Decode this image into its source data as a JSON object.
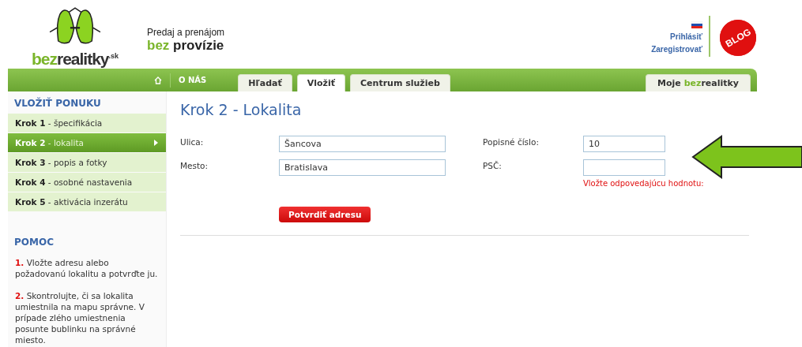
{
  "logo": {
    "brand_a": "bez",
    "brand_b": "realitky",
    "suffix": ".sk"
  },
  "tagline": {
    "line_1": "Predaj a prenájom",
    "accent": "bez",
    "rest": "provízie"
  },
  "account_links": [
    "Prihlásiť",
    "Zaregistrovať"
  ],
  "blog_badge": "BLOG",
  "nav": {
    "about": "O NÁS",
    "tabs": [
      {
        "label": "Hľadať",
        "selected": false
      },
      {
        "label": "Vložiť",
        "selected": true
      },
      {
        "label": "Centrum služieb",
        "selected": false
      }
    ],
    "my_account": {
      "prefix": "Moje",
      "brand_a": "bez",
      "brand_b": "realitky"
    }
  },
  "sidebar": {
    "title": "VLOŽIŤ PONUKU",
    "steps": [
      {
        "number": "Krok 1",
        "label": "- špecifikácia",
        "selected": false
      },
      {
        "number": "Krok 2",
        "label": "- lokalita",
        "selected": true
      },
      {
        "number": "Krok 3",
        "label": "- popis a fotky",
        "selected": false
      },
      {
        "number": "Krok 4",
        "label": "- osobné nastavenia",
        "selected": false
      },
      {
        "number": "Krok 5",
        "label": "- aktivácia inzerátu",
        "selected": false
      }
    ],
    "help_title": "POMOC",
    "help": [
      {
        "number": "1.",
        "text": "Vložte adresu alebo požadovanú lokalitu a potvrďte ju."
      },
      {
        "number": "2.",
        "text": "Skontrolujte, či sa lokalita umiestnila na mapu správne. V prípade zlého umiestnenia posunte bublinku na správné miesto."
      }
    ]
  },
  "content": {
    "title": "Krok 2 - Lokalita",
    "left_fields": [
      {
        "label": "Ulica:",
        "value": "Šancova"
      },
      {
        "label": "Mesto:",
        "value": "Bratislava"
      }
    ],
    "right_fields": [
      {
        "label": "Popisné číslo:",
        "value": "10"
      },
      {
        "label": "PSČ:",
        "error": "Vložte odpovedajúcu hodnotu:"
      }
    ],
    "submit": "Potvrdiť adresu"
  }
}
